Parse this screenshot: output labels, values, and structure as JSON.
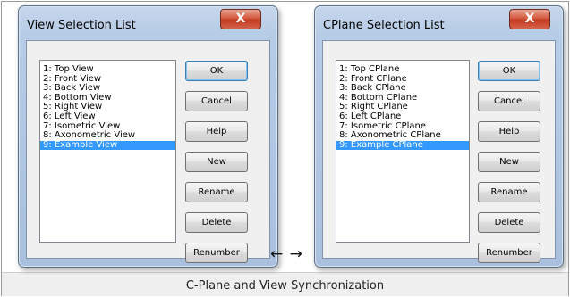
{
  "left_dialog": {
    "title": "View Selection List",
    "close_label": "X",
    "items": [
      "1: Top View",
      "2: Front View",
      "3: Back View",
      "4: Bottom View",
      "5: Right View",
      "6: Left View",
      "7: Isometric View",
      "8: Axonometric View",
      "9: Example View"
    ],
    "selected_index": 8,
    "buttons": [
      "OK",
      "Cancel",
      "Help",
      "New",
      "Rename",
      "Delete",
      "Renumber"
    ]
  },
  "right_dialog": {
    "title": "CPlane Selection List",
    "close_label": "X",
    "items": [
      "1: Top CPlane",
      "2: Front CPlane",
      "3: Back CPlane",
      "4: Bottom CPlane",
      "5: Right CPlane",
      "6: Left CPlane",
      "7: Isometric CPlane",
      "8: Axonometric CPlane",
      "9: Example CPlane"
    ],
    "selected_index": 8,
    "buttons": [
      "OK",
      "Cancel",
      "Help",
      "New",
      "Rename",
      "Delete",
      "Renumber"
    ]
  },
  "arrows": "← →",
  "caption": "C-Plane and View Synchronization"
}
